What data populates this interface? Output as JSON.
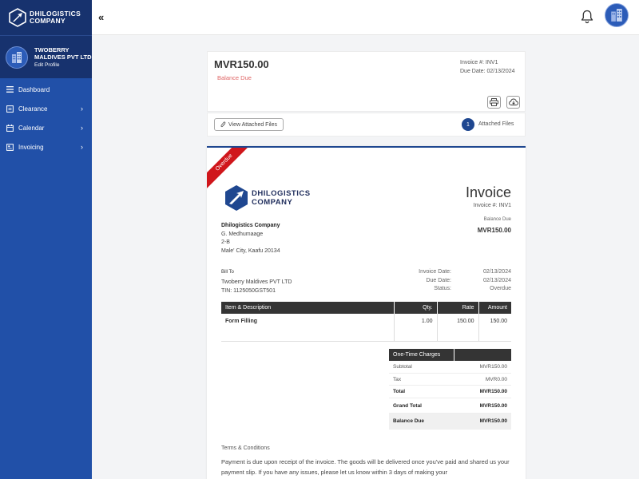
{
  "sidebar": {
    "logo_line1": "DHILOGISTICS",
    "logo_line2": "COMPANY",
    "company_name": "TWOBERRY MALDIVES PVT LTD",
    "edit_profile": "Edit Profile",
    "items": [
      {
        "label": "Dashboard",
        "icon": "menu-icon",
        "has_chevron": false
      },
      {
        "label": "Clearance",
        "icon": "clipboard-icon",
        "has_chevron": true
      },
      {
        "label": "Calendar",
        "icon": "calendar-icon",
        "has_chevron": true
      },
      {
        "label": "Invoicing",
        "icon": "invoice-icon",
        "has_chevron": true
      }
    ],
    "chevron": "›"
  },
  "topbar": {
    "collapse": "«",
    "bell_icon": "bell-icon",
    "avatar_icon": "building-avatar"
  },
  "summary": {
    "amount": "MVR150.00",
    "status": "Balance Due",
    "invoice_no": "Invoice #: INV1",
    "due_date": "Due Date: 02/13/2024",
    "print_icon": "printer-icon",
    "download_icon": "cloud-download-icon"
  },
  "attachments": {
    "button": "View Attached Files",
    "count": "1",
    "label": "Attached Files"
  },
  "invoice": {
    "ribbon": "Overdue",
    "logo_line1": "DHILOGISTICS",
    "logo_line2": "COMPANY",
    "title": "Invoice",
    "number": "Invoice #: INV1",
    "balance_due_label": "Balance Due",
    "balance_due_value": "MVR150.00",
    "from_name": "Dhilogistics Company",
    "from_line1": "G. Medhumaage",
    "from_line2": "2-B",
    "from_line3": "Male' City, Kaafu 20134",
    "bill_to_label": "Bill To",
    "bill_to_name": "Twoberry Maldives PVT LTD",
    "bill_to_tin": "TIN: 1125050GST501",
    "invoice_date_label": "Invoice Date:",
    "invoice_date": "02/13/2024",
    "due_date_label": "Due Date:",
    "due_date": "02/13/2024",
    "status_label": "Status:",
    "status": "Overdue",
    "columns": [
      "Item & Description",
      "Qty.",
      "Rate",
      "Amount"
    ],
    "rows": [
      {
        "item": "Form Filling",
        "qty": "1.00",
        "rate": "150.00",
        "amount": "150.00"
      }
    ],
    "charges_header": "One-Time Charges",
    "subtotal_label": "Subtotal",
    "subtotal": "MVR150.00",
    "tax_label": "Tax",
    "tax": "MVR0.00",
    "total_label": "Total",
    "total": "MVR150.00",
    "grand_total_label": "Grand Total",
    "grand_total": "MVR150.00",
    "balance_label": "Balance Due",
    "balance": "MVR150.00",
    "terms_label": "Terms & Conditions",
    "terms_text": "Payment is due upon receipt of the invoice. The goods will be delivered once you've paid and shared us your payment slip. If you have any issues, please let us know within 3 days of making your"
  },
  "colors": {
    "sidebar": "#2150a8",
    "sidebar_dark": "#17326e",
    "accent": "#1f4790",
    "overdue": "#d0161b",
    "balance_due_text": "#e06666"
  }
}
